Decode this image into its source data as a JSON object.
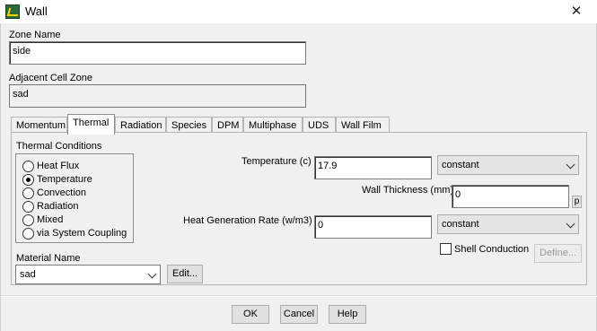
{
  "window": {
    "title": "Wall",
    "app_icon": "fluent-app-icon",
    "close_glyph": "✕"
  },
  "zone_name": {
    "label": "Zone Name",
    "value": "side"
  },
  "adjacent_cell_zone": {
    "label": "Adjacent Cell Zone",
    "value": "sad"
  },
  "tabs": [
    {
      "label": "Momentum"
    },
    {
      "label": "Thermal"
    },
    {
      "label": "Radiation"
    },
    {
      "label": "Species"
    },
    {
      "label": "DPM"
    },
    {
      "label": "Multiphase"
    },
    {
      "label": "UDS"
    },
    {
      "label": "Wall Film"
    }
  ],
  "active_tab": "Thermal",
  "thermal_conditions": {
    "label": "Thermal Conditions",
    "options": [
      {
        "label": "Heat Flux",
        "checked": false
      },
      {
        "label": "Temperature",
        "checked": true
      },
      {
        "label": "Convection",
        "checked": false
      },
      {
        "label": "Radiation",
        "checked": false
      },
      {
        "label": "Mixed",
        "checked": false
      },
      {
        "label": "via System Coupling",
        "checked": false
      }
    ]
  },
  "temperature": {
    "label": "Temperature (c)",
    "value": "17.9",
    "method": "constant"
  },
  "wall_thickness": {
    "label": "Wall Thickness (mm)",
    "value": "0",
    "p_label": "p"
  },
  "heat_generation_rate": {
    "label": "Heat Generation Rate (w/m3)",
    "value": "0",
    "method": "constant"
  },
  "shell_conduction": {
    "label": "Shell Conduction",
    "checked": false
  },
  "define_button": "Define...",
  "material": {
    "label": "Material Name",
    "value": "sad",
    "edit_label": "Edit..."
  },
  "footer": {
    "ok": "OK",
    "cancel": "Cancel",
    "help": "Help"
  }
}
